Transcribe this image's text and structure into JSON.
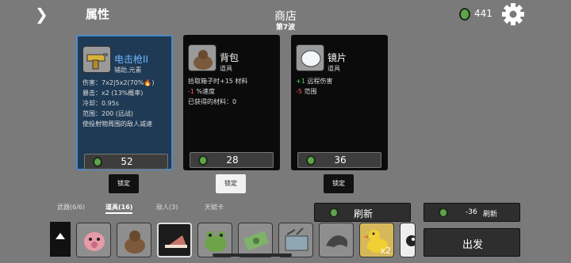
{
  "header": {
    "left_title": "属性",
    "shop_title": "商店",
    "wave_label": "第7波",
    "materials": "441"
  },
  "shop": {
    "items": [
      {
        "name": "电击枪II",
        "type": "辅助,元素",
        "stats": [
          "伤害：7x2|5x2(70%🔥)",
          "暴击：x2 (13%概率)",
          "冷却：0.95s",
          "范围：200 (远战)",
          "使投射物周围的敌人减速"
        ],
        "price": "52",
        "lock_label": "锁定",
        "locked": false,
        "selected": true
      },
      {
        "name": "背包",
        "type": "道具",
        "stats": [
          "拾取箱子时+15 材料",
          "-1 %速度",
          "已获得的材料：0"
        ],
        "price": "28",
        "lock_label": "锁定",
        "locked": true,
        "selected": false
      },
      {
        "name": "镜片",
        "type": "道具",
        "stats": [
          "+1 远程伤害",
          "-5 范围"
        ],
        "price": "36",
        "lock_label": "锁定",
        "locked": false,
        "selected": false
      }
    ]
  },
  "tabs": [
    {
      "label": "武器(6/6)",
      "active": false
    },
    {
      "label": "道具(16)",
      "active": true
    },
    {
      "label": "敌人(3)",
      "active": false
    },
    {
      "label": "天赋卡",
      "active": false
    }
  ],
  "actions": {
    "refresh_label": "刷新",
    "reroll_cost": "-36",
    "reroll_label": "刷新",
    "depart_label": "出发"
  },
  "inventory": {
    "slots": [
      {
        "icon": "pig-icon"
      },
      {
        "icon": "backpack-icon"
      },
      {
        "icon": "cake-icon"
      },
      {
        "icon": "frog-icon"
      },
      {
        "icon": "money-icon"
      },
      {
        "icon": "crate-icon"
      },
      {
        "icon": "wave-icon"
      },
      {
        "icon": "duck-icon",
        "qty": "x2"
      },
      {
        "icon": "eye-icon"
      }
    ]
  }
}
